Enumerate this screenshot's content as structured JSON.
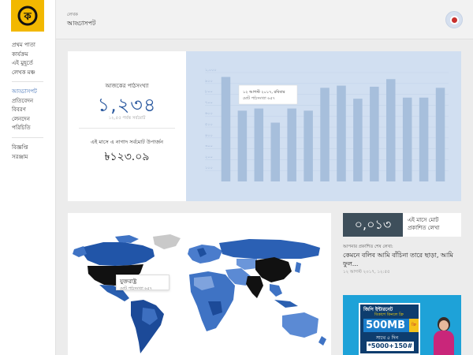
{
  "app": {
    "logo_char": "ক"
  },
  "sidebar": {
    "group1": [
      "প্রথম পাতা",
      "কার্যক্রম",
      "এই মুহূর্তে",
      "লেখক মঞ্চ"
    ],
    "group2": [
      "আড্ডাসপট",
      "প্রতিবেদন",
      "বিবরণ",
      "লেনদেন",
      "পরিচিতি"
    ],
    "group3": [
      "বিজ্ঞপ্তি",
      "সরঞ্জাম"
    ],
    "active_index": 0
  },
  "header": {
    "subtitle": "লেখক",
    "title": "আড্ডাসপট"
  },
  "stats": {
    "today_label": "আজকের পাঠসংখ্যা",
    "today_value": "১,২৩৪",
    "total_label": "১২,৫৫ পর্যন্ত সর্বমোট",
    "earnings_label": "এই মাসে এ নাগাদ সর্বমোট উপার্জন",
    "earnings_value": "৳১২৩.০৯"
  },
  "chart_data": {
    "type": "bar",
    "ylim": [
      0,
      1000
    ],
    "yticks": [
      "১,০০০",
      "৯০০",
      "৮০০",
      "৭০০",
      "৬০০",
      "৫০০",
      "৪০০",
      "৩০০",
      "২০০",
      "১০০"
    ],
    "values": [
      960,
      650,
      670,
      540,
      670,
      650,
      860,
      880,
      760,
      870,
      940,
      770,
      770,
      860
    ],
    "tooltip": {
      "line1": "১২ আগস্ট ২০১৭, রবিবার",
      "line2": "মোট পাঠসংখ্যা ৬৫৭"
    },
    "bar_color": "#a7bfdc",
    "bg_color": "#d1dff1"
  },
  "map": {
    "tooltip_title": "যুক্তরাষ্ট্র",
    "tooltip_sub": "মোট পাঠসংখ্যা ৬৫৭"
  },
  "publish": {
    "count": "০,০১৩",
    "label": "এই মাসে মোট প্রকাশিত লেখা"
  },
  "last": {
    "label": "আপনার প্রকাশিত শেষ লেখা:",
    "title": "কেমনে বলিব আমি বাঁচিনা তারে ছাড়া, আমি ফুল...",
    "date": "১২ আগস্ট ২০১৭, ১২:৫৫"
  },
  "ad": {
    "line1": "জিপি ইন্টারনেট",
    "line2": "বিকাশে কিনলে ফ্রি",
    "mb": "500MB",
    "bonus": "ফ্রি",
    "days": "সাথে ৫ দিন",
    "code": "*5000+150#"
  }
}
